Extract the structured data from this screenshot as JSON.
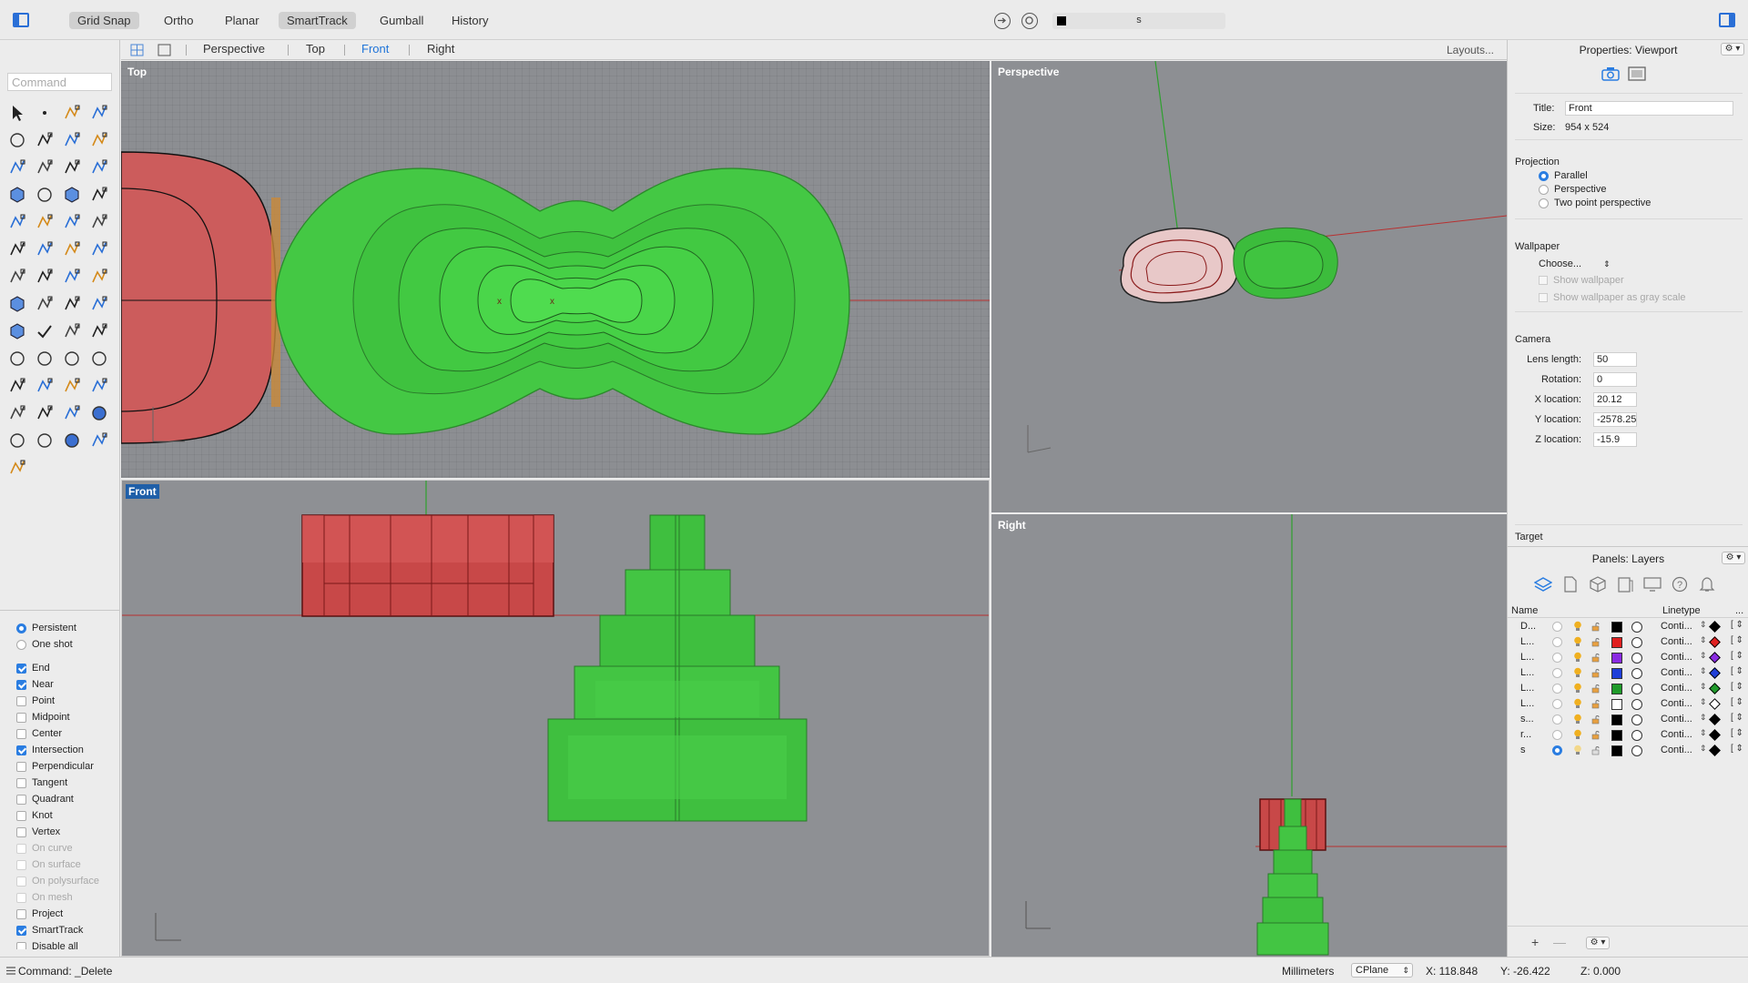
{
  "toolbar": {
    "items": [
      {
        "label": "Grid Snap",
        "on": true
      },
      {
        "label": "Ortho",
        "on": false
      },
      {
        "label": "Planar",
        "on": false
      },
      {
        "label": "SmartTrack",
        "on": true
      },
      {
        "label": "Gumball",
        "on": false
      },
      {
        "label": "History",
        "on": false
      }
    ],
    "current_layer": "s"
  },
  "command": {
    "placeholder": "Command"
  },
  "viewport_tabs": {
    "tabs": [
      "Perspective",
      "Top",
      "Front",
      "Right"
    ],
    "active": "Front",
    "layouts": "Layouts..."
  },
  "viewports": {
    "top": "Top",
    "perspective": "Perspective",
    "front": "Front",
    "right": "Right",
    "active": "Front"
  },
  "osnap": {
    "modes": [
      {
        "label": "Persistent",
        "checked": true
      },
      {
        "label": "One shot",
        "checked": false
      }
    ],
    "snaps": [
      {
        "label": "End",
        "checked": true,
        "enabled": true
      },
      {
        "label": "Near",
        "checked": true,
        "enabled": true
      },
      {
        "label": "Point",
        "checked": false,
        "enabled": true
      },
      {
        "label": "Midpoint",
        "checked": false,
        "enabled": true
      },
      {
        "label": "Center",
        "checked": false,
        "enabled": true
      },
      {
        "label": "Intersection",
        "checked": true,
        "enabled": true
      },
      {
        "label": "Perpendicular",
        "checked": false,
        "enabled": true
      },
      {
        "label": "Tangent",
        "checked": false,
        "enabled": true
      },
      {
        "label": "Quadrant",
        "checked": false,
        "enabled": true
      },
      {
        "label": "Knot",
        "checked": false,
        "enabled": true
      },
      {
        "label": "Vertex",
        "checked": false,
        "enabled": true
      },
      {
        "label": "On curve",
        "checked": false,
        "enabled": false
      },
      {
        "label": "On surface",
        "checked": false,
        "enabled": false
      },
      {
        "label": "On polysurface",
        "checked": false,
        "enabled": false
      },
      {
        "label": "On mesh",
        "checked": false,
        "enabled": false
      },
      {
        "label": "Project",
        "checked": false,
        "enabled": true
      },
      {
        "label": "SmartTrack",
        "checked": true,
        "enabled": true
      },
      {
        "label": "Disable all",
        "checked": false,
        "enabled": true
      }
    ]
  },
  "properties": {
    "title": "Properties: Viewport",
    "title_label": "Title:",
    "title_value": "Front",
    "size_label": "Size:",
    "size_value": "954 x 524",
    "projection_head": "Projection",
    "projection_options": [
      {
        "label": "Parallel",
        "checked": true
      },
      {
        "label": "Perspective",
        "checked": false
      },
      {
        "label": "Two point perspective",
        "checked": false
      }
    ],
    "wallpaper_head": "Wallpaper",
    "wallpaper_choose": "Choose...",
    "show_wallpaper": "Show wallpaper",
    "show_wallpaper_gray": "Show wallpaper as gray scale",
    "camera_head": "Camera",
    "camera_fields": [
      {
        "label": "Lens length:",
        "value": "50"
      },
      {
        "label": "Rotation:",
        "value": "0"
      },
      {
        "label": "X location:",
        "value": "20.12"
      },
      {
        "label": "Y location:",
        "value": "-2578.25"
      },
      {
        "label": "Z location:",
        "value": "-15.9"
      }
    ],
    "target_head": "Target",
    "gear": "⚙ ▾"
  },
  "layers": {
    "title": "Panels: Layers",
    "col_name": "Name",
    "col_linetype": "Linetype",
    "col_more": "...",
    "rows": [
      {
        "name": "D...",
        "color": "#000000",
        "linetype": "Conti...",
        "current": false,
        "print": "#000000"
      },
      {
        "name": "L...",
        "color": "#e02020",
        "linetype": "Conti...",
        "current": false,
        "print": "#e02020"
      },
      {
        "name": "L...",
        "color": "#8a2be2",
        "linetype": "Conti...",
        "current": false,
        "print": "#8a2be2"
      },
      {
        "name": "L...",
        "color": "#1f3fd9",
        "linetype": "Conti...",
        "current": false,
        "print": "#1f3fd9"
      },
      {
        "name": "L...",
        "color": "#1f9a2a",
        "linetype": "Conti...",
        "current": false,
        "print": "#1f9a2a"
      },
      {
        "name": "L...",
        "color": "#ffffff",
        "linetype": "Conti...",
        "current": false,
        "print": "#ffffff"
      },
      {
        "name": "s...",
        "color": "#000000",
        "linetype": "Conti...",
        "current": false,
        "print": "#000000"
      },
      {
        "name": "r...",
        "color": "#000000",
        "linetype": "Conti...",
        "current": false,
        "print": "#000000"
      },
      {
        "name": "s",
        "color": "#000000",
        "linetype": "Conti...",
        "current": true,
        "print": "#000000"
      }
    ]
  },
  "status": {
    "command": "Command: _Delete",
    "units": "Millimeters",
    "cplane": "CPlane",
    "x": "X: 118.848",
    "y": "Y: -26.422",
    "z": "Z: 0.000"
  },
  "colors": {
    "accent": "#1f74d9",
    "object_green": "#3cc43c",
    "object_red": "#c85a5a",
    "axis_red": "#c03030",
    "axis_green": "#30a030"
  }
}
